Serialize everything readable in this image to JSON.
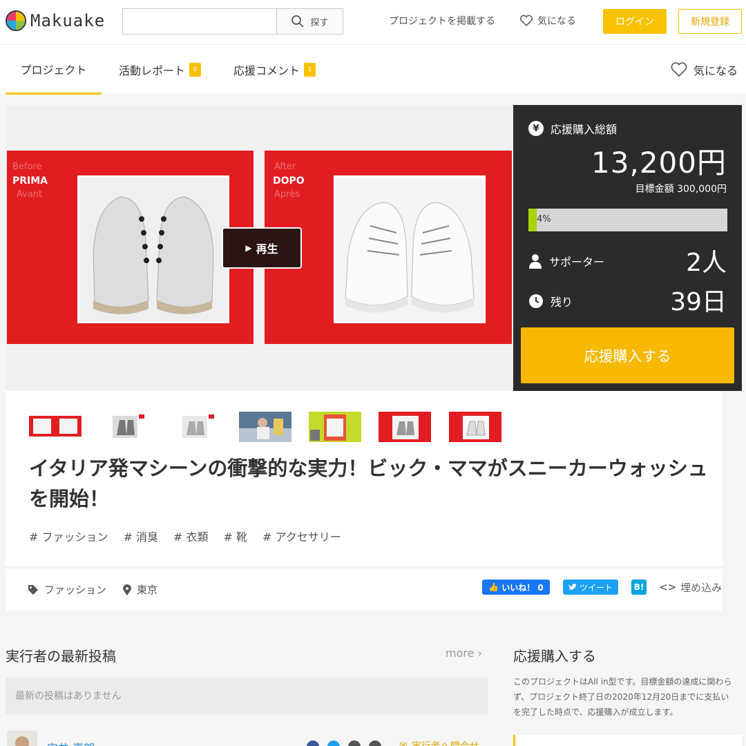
{
  "header": {
    "logo_text": "Makuake",
    "search_placeholder": "",
    "search_button": "探す",
    "post_project": "プロジェクトを掲載する",
    "favorite": "気になる",
    "login": "ログイン",
    "signup": "新規登録"
  },
  "tabs": {
    "items": [
      {
        "label": "プロジェクト",
        "badge": ""
      },
      {
        "label": "活動レポート",
        "badge": "0"
      },
      {
        "label": "応援コメント",
        "badge": "1"
      }
    ],
    "favorite": "気になる"
  },
  "hero": {
    "before_small": "Before",
    "before_main": "PRIMA",
    "before_sub": "Avant",
    "after_small": "After",
    "after_main": "DOPO",
    "after_sub": "Après",
    "play_label": "再生",
    "colors": {
      "panel": "#e11d22"
    }
  },
  "stats": {
    "total_label": "応援購入総額",
    "total_amount": "13,200円",
    "target": "目標金額 300,000円",
    "progress_text": "4%",
    "progress_value": 0.04,
    "supporters_label": "サポーター",
    "supporters_value": "2人",
    "remaining_label": "残り",
    "remaining_value": "39日",
    "cta": "応援購入する",
    "colors": {
      "accent": "#f7b800",
      "progress": "#a8d400"
    }
  },
  "project": {
    "title": "イタリア発マシーンの衝撃的な実力！ビック・ママがスニーカーウォッシュを開始！",
    "tags": [
      "# ファッション",
      "# 消臭",
      "# 衣類",
      "# 靴",
      "# アクセサリー"
    ],
    "category": "ファッション",
    "location": "東京"
  },
  "share": {
    "like": "いいね！ 0",
    "tweet": "ツイート",
    "hatena": "B!",
    "embed": "埋め込み"
  },
  "posts": {
    "title": "実行者の最新投稿",
    "more": "more",
    "empty": "最新の投稿はありません"
  },
  "author": {
    "name": "安井 嘉朗",
    "contact": "実行者へ問合せ"
  },
  "support": {
    "title": "応援購入する",
    "description": "このプロジェクトはAll in型です。目標金額の達成に関わらず、プロジェクト終了日の2020年12月20日までに支払いを完了した時点で、応援購入が成立します。"
  }
}
